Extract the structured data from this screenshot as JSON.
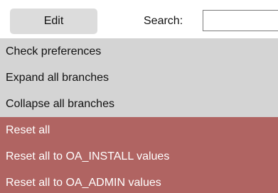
{
  "toolbar": {
    "edit_label": "Edit",
    "search_label": "Search:",
    "search_value": ""
  },
  "menu": {
    "items": [
      {
        "label": "Check preferences",
        "kind": "normal"
      },
      {
        "label": "Expand all branches",
        "kind": "normal"
      },
      {
        "label": "Collapse all branches",
        "kind": "normal"
      },
      {
        "label": "Reset all",
        "kind": "danger"
      },
      {
        "label": "Reset all to OA_INSTALL values",
        "kind": "danger"
      },
      {
        "label": "Reset all to OA_ADMIN values",
        "kind": "danger"
      }
    ]
  },
  "colors": {
    "tab_bg": "#dcdcdc",
    "menu_bg": "#d4d4d4",
    "danger_bg": "#b06462",
    "danger_text": "#ffffff"
  }
}
